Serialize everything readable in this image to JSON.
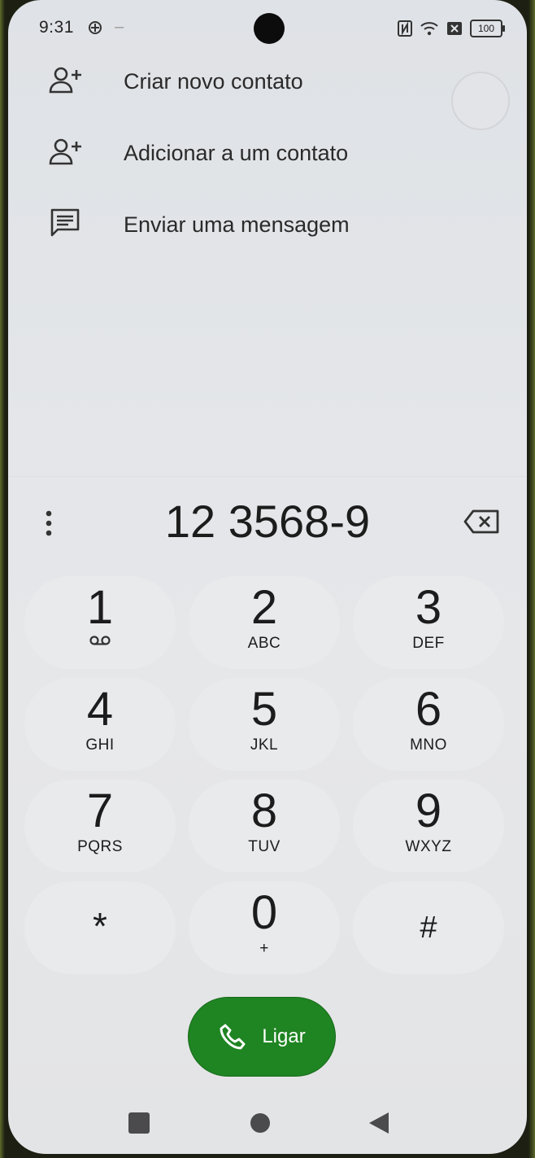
{
  "status_bar": {
    "time": "9:31",
    "dash": "–",
    "battery": "100"
  },
  "menu": [
    {
      "label": "Criar novo contato",
      "icon": "add-person-icon"
    },
    {
      "label": "Adicionar a um contato",
      "icon": "add-person-icon"
    },
    {
      "label": "Enviar uma mensagem",
      "icon": "message-icon"
    }
  ],
  "dialer": {
    "number": "12 3568-9",
    "keys": [
      {
        "digit": "1",
        "letters": ""
      },
      {
        "digit": "2",
        "letters": "ABC"
      },
      {
        "digit": "3",
        "letters": "DEF"
      },
      {
        "digit": "4",
        "letters": "GHI"
      },
      {
        "digit": "5",
        "letters": "JKL"
      },
      {
        "digit": "6",
        "letters": "MNO"
      },
      {
        "digit": "7",
        "letters": "PQRS"
      },
      {
        "digit": "8",
        "letters": "TUV"
      },
      {
        "digit": "9",
        "letters": "WXYZ"
      },
      {
        "digit": "*",
        "letters": ""
      },
      {
        "digit": "0",
        "letters": "+"
      },
      {
        "digit": "#",
        "letters": ""
      }
    ],
    "call_label": "Ligar",
    "call_color": "#1f8422"
  }
}
